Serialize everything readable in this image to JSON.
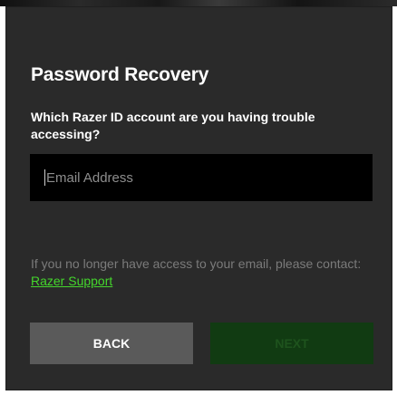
{
  "dialog": {
    "title": "Password Recovery",
    "question": "Which Razer ID account are you having trouble accessing?",
    "email_placeholder": "Email Address",
    "email_value": "",
    "help_text": "If you no longer have access to your email, please contact:",
    "support_link_label": "Razer Support",
    "back_label": "BACK",
    "next_label": "NEXT",
    "next_enabled": false
  },
  "colors": {
    "panel_background": "#2a2a2a",
    "input_background": "#000000",
    "accent_green": "#44d62c",
    "back_button": "#5a5a5a",
    "next_button_disabled": "#113b12"
  }
}
